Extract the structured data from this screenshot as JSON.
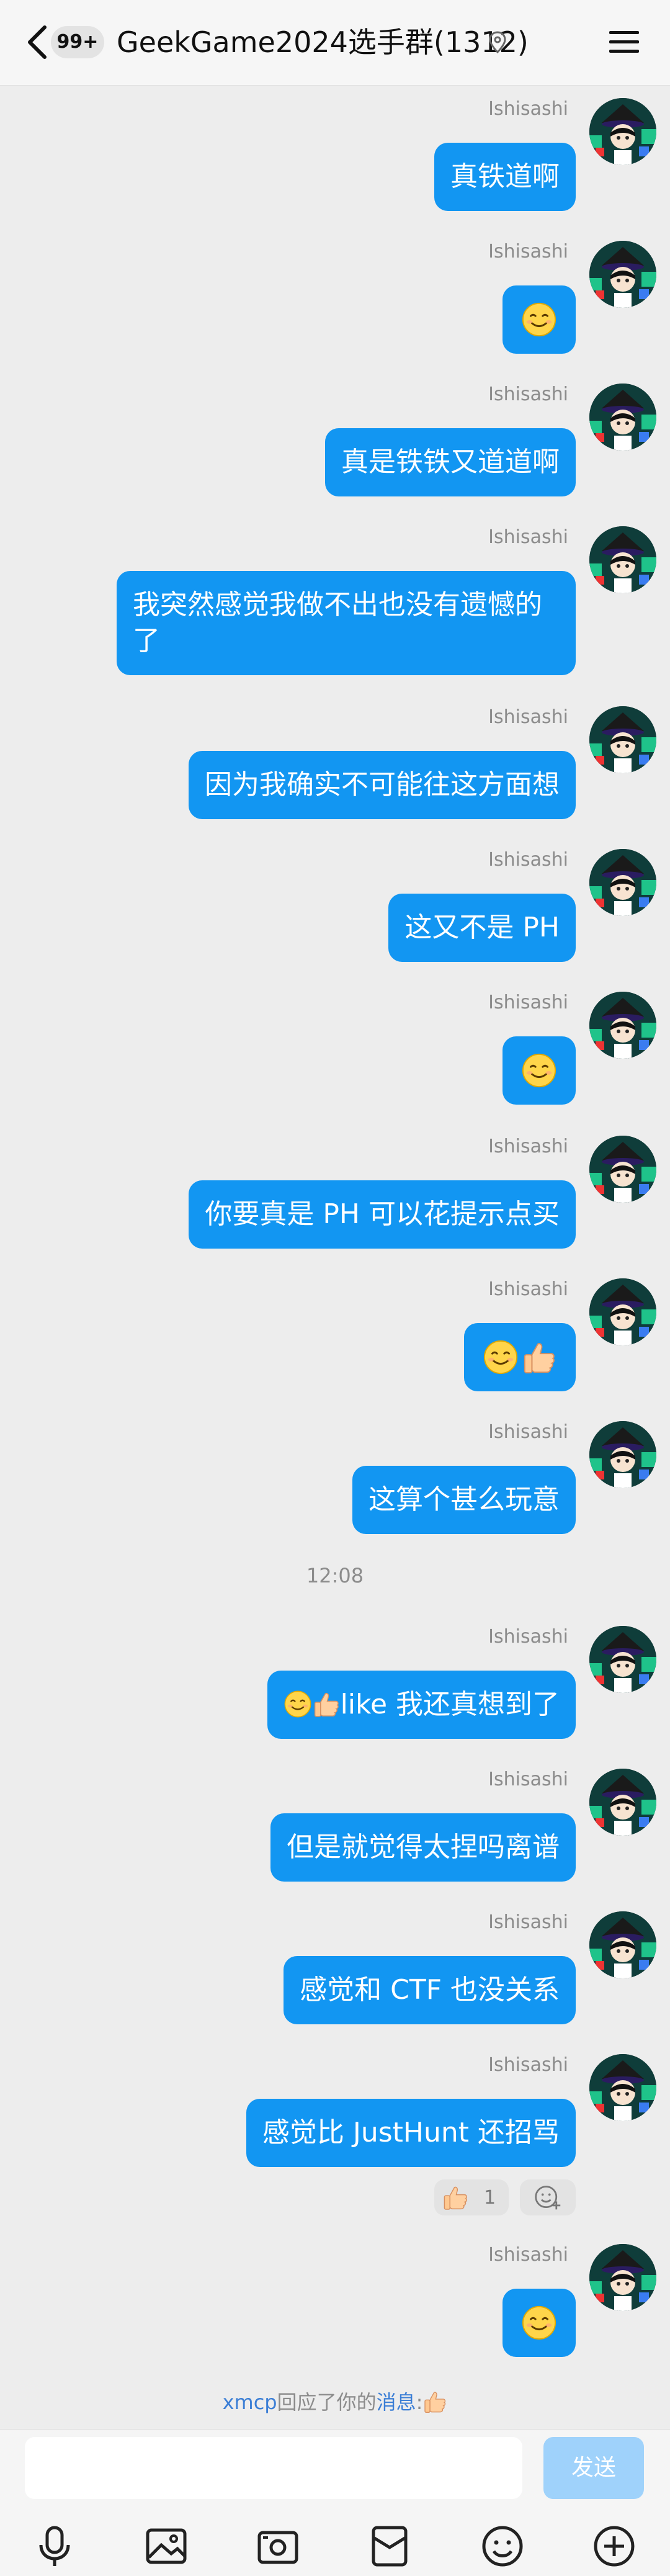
{
  "header": {
    "unread_badge": "99+",
    "title": "GeekGame2024选手群(1312)"
  },
  "sender": "Ishisashi",
  "messages": [
    {
      "type": "text",
      "text": "真铁道啊"
    },
    {
      "type": "emoji",
      "icons": [
        "smile-emoji"
      ]
    },
    {
      "type": "text",
      "text": "真是铁铁又道道啊"
    },
    {
      "type": "text",
      "text": "我突然感觉我做不出也没有遗憾的了",
      "lines": [
        "我突然感觉我做不出也没有遗憾的",
        "了"
      ]
    },
    {
      "type": "text",
      "text": "因为我确实不可能往这方面想"
    },
    {
      "type": "text",
      "text": "这又不是 PH"
    },
    {
      "type": "emoji",
      "icons": [
        "smile-emoji"
      ]
    },
    {
      "type": "text",
      "text": "你要真是 PH 可以花提示点买"
    },
    {
      "type": "emoji",
      "icons": [
        "smile-emoji",
        "thumbs-up-emoji"
      ]
    },
    {
      "type": "text",
      "text": "这算个甚么玩意"
    },
    {
      "type": "time",
      "text": "12:08"
    },
    {
      "type": "text",
      "text": "like 我还真想到了",
      "prefix_icons": [
        "smile-emoji",
        "thumbs-up-emoji"
      ]
    },
    {
      "type": "text",
      "text": "但是就觉得太捏吗离谱"
    },
    {
      "type": "text",
      "text": "感觉和 CTF 也没关系"
    },
    {
      "type": "text",
      "text": "感觉比 JustHunt 还招骂"
    },
    {
      "type": "emoji",
      "icons": [
        "smile-emoji"
      ]
    }
  ],
  "reaction": {
    "icon": "thumbs-up-emoji",
    "count": "1"
  },
  "system_notice": {
    "user": "xmcp",
    "middle": "回应了你的",
    "link": "消息",
    "suffix": ":"
  },
  "footer": {
    "input_value": "",
    "send_label": "发送",
    "toolbar_icons": [
      "microphone-icon",
      "image-icon",
      "camera-icon",
      "red-packet-icon",
      "emoji-icon",
      "plus-icon"
    ]
  },
  "colors": {
    "bubble": "#1296f2",
    "background": "#ededed",
    "send_disabled": "#9fd2fb",
    "link": "#3c7fd6"
  }
}
